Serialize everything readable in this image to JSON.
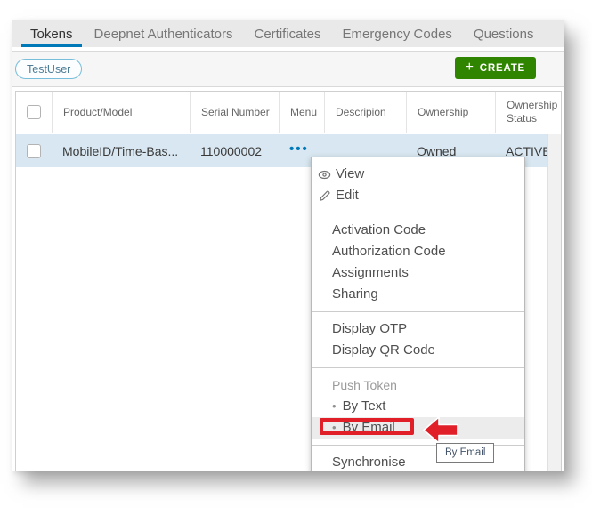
{
  "tabs": {
    "items": [
      {
        "label": "Tokens",
        "active": true
      },
      {
        "label": "Deepnet Authenticators",
        "active": false
      },
      {
        "label": "Certificates",
        "active": false
      },
      {
        "label": "Emergency Codes",
        "active": false
      },
      {
        "label": "Questions",
        "active": false
      }
    ]
  },
  "toolbar": {
    "filter_chip": "TestUser",
    "create_label": "CREATE",
    "create_icon": "plus-icon"
  },
  "table": {
    "columns": [
      "Product/Model",
      "Serial Number",
      "Menu",
      "Descripion",
      "Ownership",
      "Ownership Status"
    ],
    "rows": [
      {
        "product_model": "MobileID/Time-Bas...",
        "serial_number": "110000002",
        "menu_icon": "ellipsis-icon",
        "description": "",
        "ownership": "Owned",
        "ownership_status": "ACTIVE"
      }
    ]
  },
  "menu": {
    "view": "View",
    "view_icon": "eye-icon",
    "edit": "Edit",
    "edit_icon": "pencil-icon",
    "activation_code": "Activation Code",
    "authorization_code": "Authorization Code",
    "assignments": "Assignments",
    "sharing": "Sharing",
    "display_otp": "Display OTP",
    "display_qr_code": "Display QR Code",
    "push_token_label": "Push Token",
    "by_text": "By Text",
    "by_email": "By Email",
    "synchronise": "Synchronise"
  },
  "annotation": {
    "tooltip_text": "By Email",
    "highlighted_item": "By Email"
  },
  "colors": {
    "accent_blue": "#0079b8",
    "create_green": "#2f8400",
    "annotation_red": "#e01f28",
    "selected_row": "#d8e7f1",
    "tab_bar_bg": "#e9e9e9"
  }
}
